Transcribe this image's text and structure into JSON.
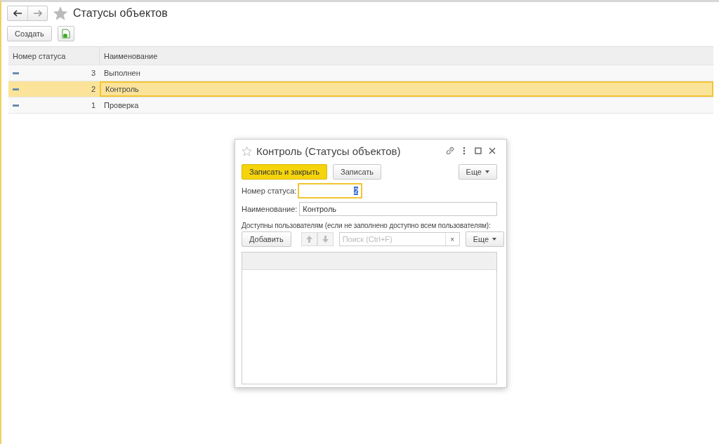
{
  "page": {
    "title": "Статусы объектов",
    "create_button": "Создать"
  },
  "table": {
    "columns": [
      "Номер статуса",
      "Наименование"
    ],
    "rows": [
      {
        "number": "3",
        "name": "Выполнен",
        "selected": false
      },
      {
        "number": "2",
        "name": "Контроль",
        "selected": true
      },
      {
        "number": "1",
        "name": "Проверка",
        "selected": false
      }
    ]
  },
  "dialog": {
    "title": "Контроль (Статусы объектов)",
    "favorite": false,
    "save_close_button": "Записать и закрыть",
    "save_button": "Записать",
    "more_button": "Еще",
    "fields": [
      {
        "label": "Номер статуса:",
        "value": "2",
        "focused": true,
        "value_selected": true,
        "kind": "number"
      },
      {
        "label": "Наименование:",
        "value": "Контроль",
        "focused": false,
        "value_selected": false,
        "kind": "text"
      }
    ],
    "users_label": "Доступны пользователям (если не заполнено доступно всем пользователям):",
    "add_button": "Добавить",
    "search": {
      "placeholder": "Поиск (Ctrl+F)"
    },
    "clear_button": "×",
    "list_more_button": "Еще"
  }
}
